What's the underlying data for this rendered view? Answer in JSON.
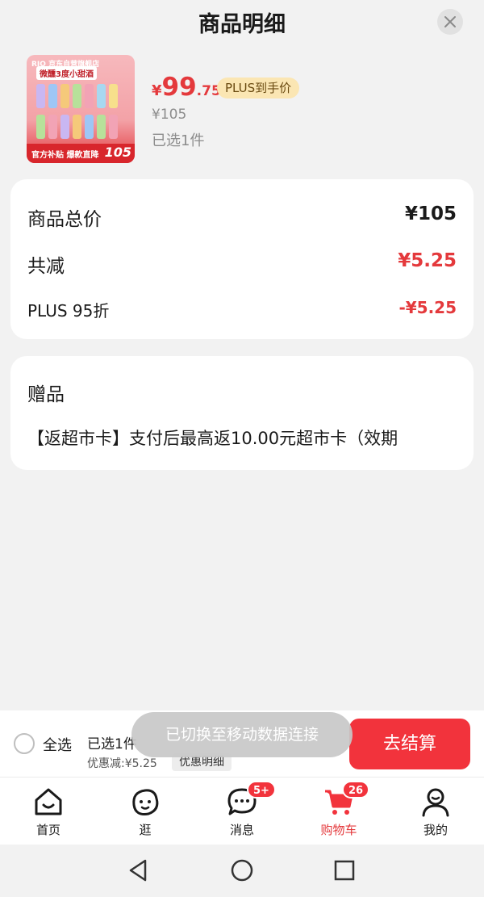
{
  "header": {
    "title": "商品明细"
  },
  "product": {
    "thumb": {
      "brand": "RIO 京东自营旗舰店",
      "headline": "微醺3度小甜酒",
      "banner_text": "官方补贴 爆款直降",
      "banner_price": "105"
    },
    "price_symbol": "¥",
    "price_int": "99",
    "price_dec": ".75",
    "plus_badge": "PLUS到手价",
    "original_price": "¥105",
    "selected": "已选1件"
  },
  "summary": {
    "rows": [
      {
        "label": "商品总价",
        "value": "¥105"
      },
      {
        "label": "共减",
        "value": "¥5.25"
      },
      {
        "label": "PLUS 95折",
        "value": "-¥5.25"
      }
    ]
  },
  "gift": {
    "title": "赠品",
    "item": "【返超市卡】支付后最高返10.00元超市卡（效期"
  },
  "bottom_bar": {
    "select_all": "全选",
    "selected": "已选1件",
    "discount": "优惠减:¥5.25",
    "detail_button": "优惠明细",
    "checkout": "去结算",
    "toast": "已切换至移动数据连接"
  },
  "tabs": [
    {
      "label": "首页",
      "icon": "home-icon"
    },
    {
      "label": "逛",
      "icon": "browse-face-icon"
    },
    {
      "label": "消息",
      "icon": "message-icon",
      "badge": "5+"
    },
    {
      "label": "购物车",
      "icon": "cart-icon",
      "badge": "26",
      "active": true
    },
    {
      "label": "我的",
      "icon": "profile-icon"
    }
  ],
  "colors": {
    "accent": "#e4393c",
    "plus_gold": "#fbe6b3",
    "background": "#f2f2f2"
  }
}
